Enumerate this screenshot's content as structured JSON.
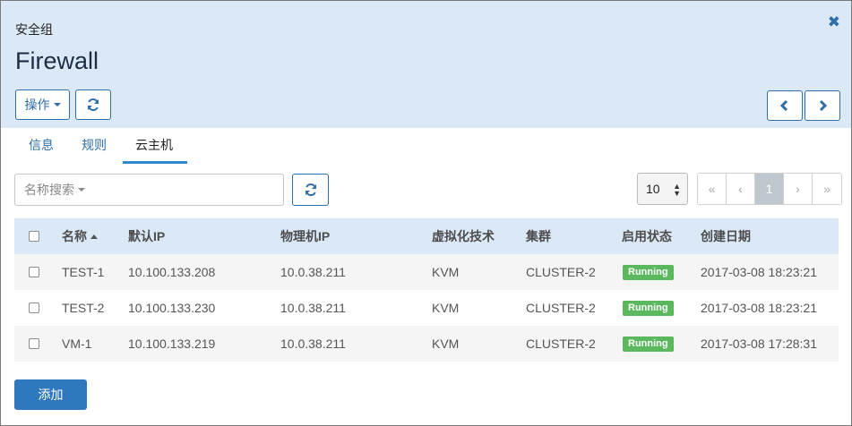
{
  "header": {
    "subtitle": "安全组",
    "title": "Firewall",
    "close_icon": "✖",
    "ops_label": "操作",
    "refresh_icon": "refresh-icon",
    "prev_icon": "chevron-left-icon",
    "next_icon": "chevron-right-icon"
  },
  "tabs": [
    {
      "label": "信息",
      "active": false
    },
    {
      "label": "规则",
      "active": false
    },
    {
      "label": "云主机",
      "active": true
    }
  ],
  "toolbar": {
    "search_placeholder": "名称搜索",
    "page_size": "10",
    "pager": [
      "«",
      "‹",
      "1",
      "›",
      "»"
    ],
    "current_page": "1"
  },
  "table": {
    "columns": [
      "名称",
      "默认IP",
      "物理机IP",
      "虚拟化技术",
      "集群",
      "启用状态",
      "创建日期"
    ],
    "rows": [
      {
        "name": "TEST-1",
        "default_ip": "10.100.133.208",
        "host_ip": "10.0.38.211",
        "virt": "KVM",
        "cluster": "CLUSTER-2",
        "status": "Running",
        "created": "2017-03-08 18:23:21"
      },
      {
        "name": "TEST-2",
        "default_ip": "10.100.133.230",
        "host_ip": "10.0.38.211",
        "virt": "KVM",
        "cluster": "CLUSTER-2",
        "status": "Running",
        "created": "2017-03-08 18:23:21"
      },
      {
        "name": "VM-1",
        "default_ip": "10.100.133.219",
        "host_ip": "10.0.38.211",
        "virt": "KVM",
        "cluster": "CLUSTER-2",
        "status": "Running",
        "created": "2017-03-08 17:28:31"
      }
    ]
  },
  "footer": {
    "add_label": "添加"
  },
  "colors": {
    "header_bg": "#dbe9f6",
    "accent": "#2f6ea9",
    "primary_button": "#2f78bd",
    "running_badge": "#5cb85c"
  }
}
